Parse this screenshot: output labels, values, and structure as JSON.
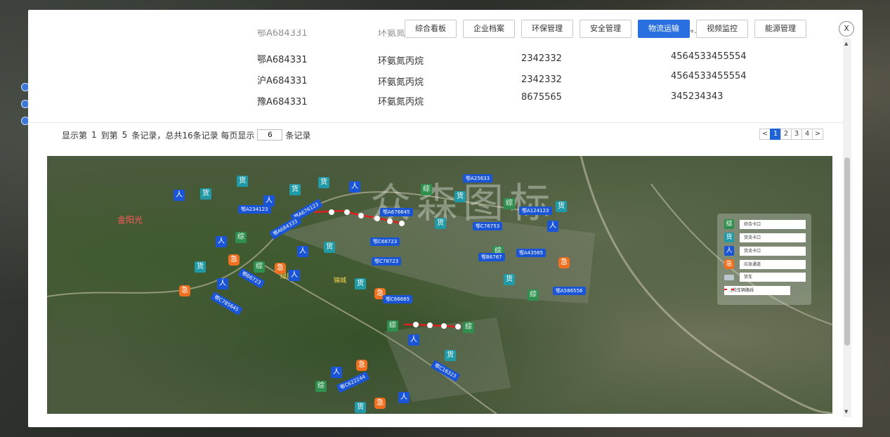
{
  "nav": {
    "tabs": [
      {
        "label": "综合看板",
        "active": false
      },
      {
        "label": "企业档案",
        "active": false
      },
      {
        "label": "环保管理",
        "active": false
      },
      {
        "label": "安全管理",
        "active": false
      },
      {
        "label": "物流运输",
        "active": true
      },
      {
        "label": "视频监控",
        "active": false
      },
      {
        "label": "能源管理",
        "active": false
      }
    ],
    "close_label": "X"
  },
  "table": {
    "partial_row": [
      "鄂A684331",
      "环氨氮丙烷",
      "2342332",
      "4564533455554"
    ],
    "rows": [
      [
        "鄂A684331",
        "环氨氮丙烷",
        "2342332",
        "4564533455554"
      ],
      [
        "沪A684331",
        "环氨氮丙烷",
        "2342332",
        "4564533455554"
      ],
      [
        "豫A684331",
        "环氨氮丙烷",
        "8675565",
        "345234343"
      ]
    ]
  },
  "pagination": {
    "info_prefix": "显示第",
    "from": "1",
    "info_mid": "到第",
    "to": "5",
    "info_total": "条记录，总共16条记录 每页显示",
    "page_size": "6",
    "info_suffix": "条记录",
    "prev": "<",
    "pages": [
      "1",
      "2",
      "3",
      "4"
    ],
    "current_page": "1",
    "next": ">"
  },
  "map": {
    "watermark": "众森图标",
    "labels": [
      "金阳光",
      "绿辰",
      "锦城"
    ],
    "plates": [
      "鄂A234123",
      "鄂A676123",
      "鄂A684333",
      "鄂B6723",
      "鄂C785645",
      "鄂A25633",
      "鄂A676645",
      "鄂A124123",
      "鄂C76753",
      "鄂C66723",
      "鄂C78723",
      "鄂B6767",
      "鄂A43565",
      "鄂A586556",
      "鄂C66665",
      "鄂C16323",
      "鄂C622244"
    ],
    "marker_text": {
      "zong": "综",
      "huo": "货",
      "ren": "人",
      "ji": "急"
    },
    "legend": [
      {
        "icon": "综",
        "kind": "z",
        "text": "综合卡口"
      },
      {
        "icon": "货",
        "kind": "h",
        "text": "货流卡口"
      },
      {
        "icon": "人",
        "kind": "r",
        "text": "货流卡口"
      },
      {
        "icon": "急",
        "kind": "j",
        "text": "应急通道"
      },
      {
        "icon": "",
        "kind": "truck",
        "text": "货车"
      },
      {
        "icon": "",
        "kind": "route",
        "text": "危险车辆路线"
      }
    ]
  },
  "colors": {
    "accent": "#2a6fe0",
    "route": "#e02020",
    "zong": "#2f8f4e",
    "huo": "#1f9aa6",
    "ren": "#1a55d8",
    "ji": "#f07020"
  }
}
